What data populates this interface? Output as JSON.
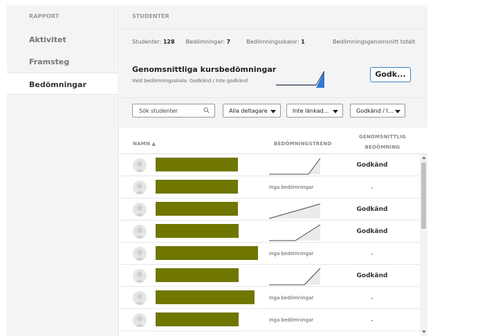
{
  "sidebar": {
    "header": "RAPPORT",
    "items": [
      {
        "label": "Aktivitet",
        "active": false
      },
      {
        "label": "Framsteg",
        "active": false
      },
      {
        "label": "Bedömningar",
        "active": true
      }
    ]
  },
  "main": {
    "header": "STUDENTER",
    "stats": {
      "students_label": "Studenter:",
      "students_value": "128",
      "grades_label": "Bedömningar:",
      "grades_value": "7",
      "scales_label": "Bedömningsskalor:",
      "scales_value": "1",
      "total_label": "Bedömningsgenomsnitt totalt"
    },
    "average": {
      "title": "Genomsnittliga kursbedömningar",
      "subtitle": "Vald bedömningsskala: Godkänd / Inte godkänd",
      "button_label": "Godk..."
    },
    "filters": {
      "search_placeholder": "Sök studenter",
      "participants": "Alla deltagare",
      "linked": "Inte länkad...",
      "scale": "Godkänd / I..."
    },
    "table": {
      "col_name": "NAMN ▲",
      "col_trend": "BEDÖMNINGSTREND",
      "col_avg_1": "GENOMSNITTLIG",
      "col_avg_2": "BEDÖMNING",
      "rows": [
        {
          "trend_text": "",
          "grade": "Godkänd"
        },
        {
          "trend_text": "Inga bedömningar",
          "grade": "-"
        },
        {
          "trend_text": "",
          "grade": "Godkänd"
        },
        {
          "trend_text": "",
          "grade": "Godkänd"
        },
        {
          "trend_text": "Inga bedömningar",
          "grade": "-"
        },
        {
          "trend_text": "",
          "grade": "Godkänd"
        },
        {
          "trend_text": "Inga bedömningar",
          "grade": "-"
        },
        {
          "trend_text": "Inga bedömningar",
          "grade": "-"
        }
      ]
    }
  },
  "colors": {
    "redaction": "#6f7700",
    "accent": "#3b82c4",
    "sidebar_bg": "#f4f4f4"
  },
  "icons": {
    "search": "search-icon",
    "avatar": "user-avatar-icon",
    "sort": "sort-ascending-icon"
  }
}
